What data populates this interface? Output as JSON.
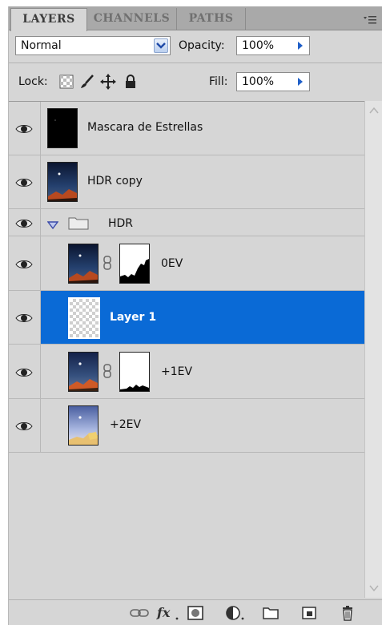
{
  "tabs": [
    {
      "label": "LAYERS"
    },
    {
      "label": "CHANNELS"
    },
    {
      "label": "PATHS"
    }
  ],
  "blend": {
    "mode": "Normal",
    "opacity_label": "Opacity:",
    "opacity_value": "100%"
  },
  "lock": {
    "label": "Lock:",
    "fill_label": "Fill:",
    "fill_value": "100%"
  },
  "layers": [
    {
      "name": "Mascara de Estrellas",
      "thumb": "black-fill",
      "visible": true
    },
    {
      "name": "HDR copy",
      "thumb": "night-sky-photo",
      "visible": true
    },
    {
      "name": "HDR",
      "type": "group",
      "expanded": true,
      "visible": true
    },
    {
      "name": "0EV",
      "thumb": "night-sky-photo",
      "mask": true,
      "visible": true
    },
    {
      "name": "Layer 1",
      "thumb": "transparent",
      "selected": true,
      "visible": true
    },
    {
      "name": "+1EV",
      "thumb": "night-sky-photo",
      "mask": true,
      "visible": true
    },
    {
      "name": "+2EV",
      "thumb": "bright-sky-photo",
      "visible": true
    }
  ],
  "colors": {
    "selection": "#0a6ad6",
    "panel": "#d6d6d6"
  },
  "bottom_icons": [
    "link-layers-icon",
    "fx-icon",
    "add-mask-icon",
    "adjustment-layer-icon",
    "new-group-icon",
    "new-layer-icon",
    "trash-icon"
  ]
}
